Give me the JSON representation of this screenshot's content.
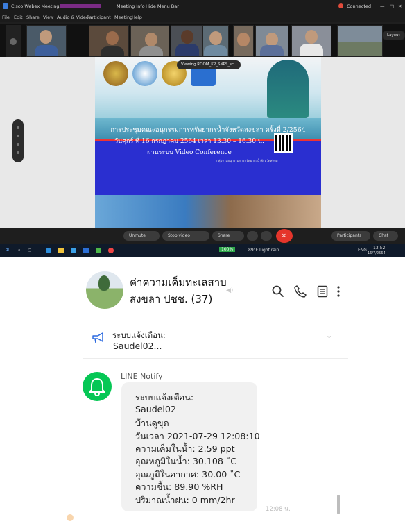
{
  "zoom": {
    "app_title": "Cisco Webex Meetings",
    "meeting_info": "Meeting Info",
    "hide_menu": "Hide Menu Bar",
    "connected": "Connected",
    "menu": [
      "File",
      "Edit",
      "Share",
      "View",
      "Audio & Video",
      "Participant",
      "Meeting",
      "Help"
    ],
    "layout_label": "Layout",
    "viewing_chip": "Viewing ROOM_KP_SNPS_sc...",
    "slide": {
      "title": "การประชุมคณะอนุกรรมการทรัพยากรน้ำจังหวัดสงขลา ครั้งที่ 2/2564",
      "date": "วันศุกร์ ที่ 16 กรกฎาคม 2564 เวลา 13.30 – 16.30 น.",
      "via": "ผ่านระบบ Video Conference",
      "credit": "กลุ่มงานอนุกรรมการทรัพยากรน้ำจังหวัดสงขลา"
    },
    "toolbar": {
      "unmute": "Unmute",
      "stop_video": "Stop video",
      "share": "Share",
      "participants": "Participants",
      "chat": "Chat"
    },
    "taskbar": {
      "battery": "100%",
      "weather": "89°F Light rain",
      "lang": "ENG",
      "time": "13:52",
      "date": "16/7/2564"
    }
  },
  "chat": {
    "title_line1": "ค่าความเค็มทะเลสาบ",
    "title_line2": "สงขลา ปชช. (37)",
    "announcement_label": "ระบบแจ้งเตือน:",
    "announcement_text": "Saudel02...",
    "sender": "LINE Notify",
    "message_lines": [
      "ระบบแจ้งเตือน:",
      "Saudel02",
      "บ้านดูขุด",
      "วันเวลา 2021-07-29 12:08:10",
      "ความเค็มในน้ำ:  2.59 ppt",
      "อุณหภูมิในน้ำ:  30.108 ˚C",
      "อุณภูมิในอากาศ:  30.00 ˚C",
      "ความชื้น:  89.90 %RH",
      "ปริมาณน้ำฝน:  0 mm/2hr"
    ],
    "time": "12:08 น."
  },
  "icons": {
    "search": "search-icon",
    "call": "phone-icon",
    "notes": "notes-icon",
    "more": "more-vertical-icon",
    "announce": "megaphone-icon",
    "bot": "bell-icon"
  },
  "colors": {
    "line_green": "#06c755",
    "slide_blue": "#2a2fd0",
    "end_call_red": "#e5352b"
  }
}
